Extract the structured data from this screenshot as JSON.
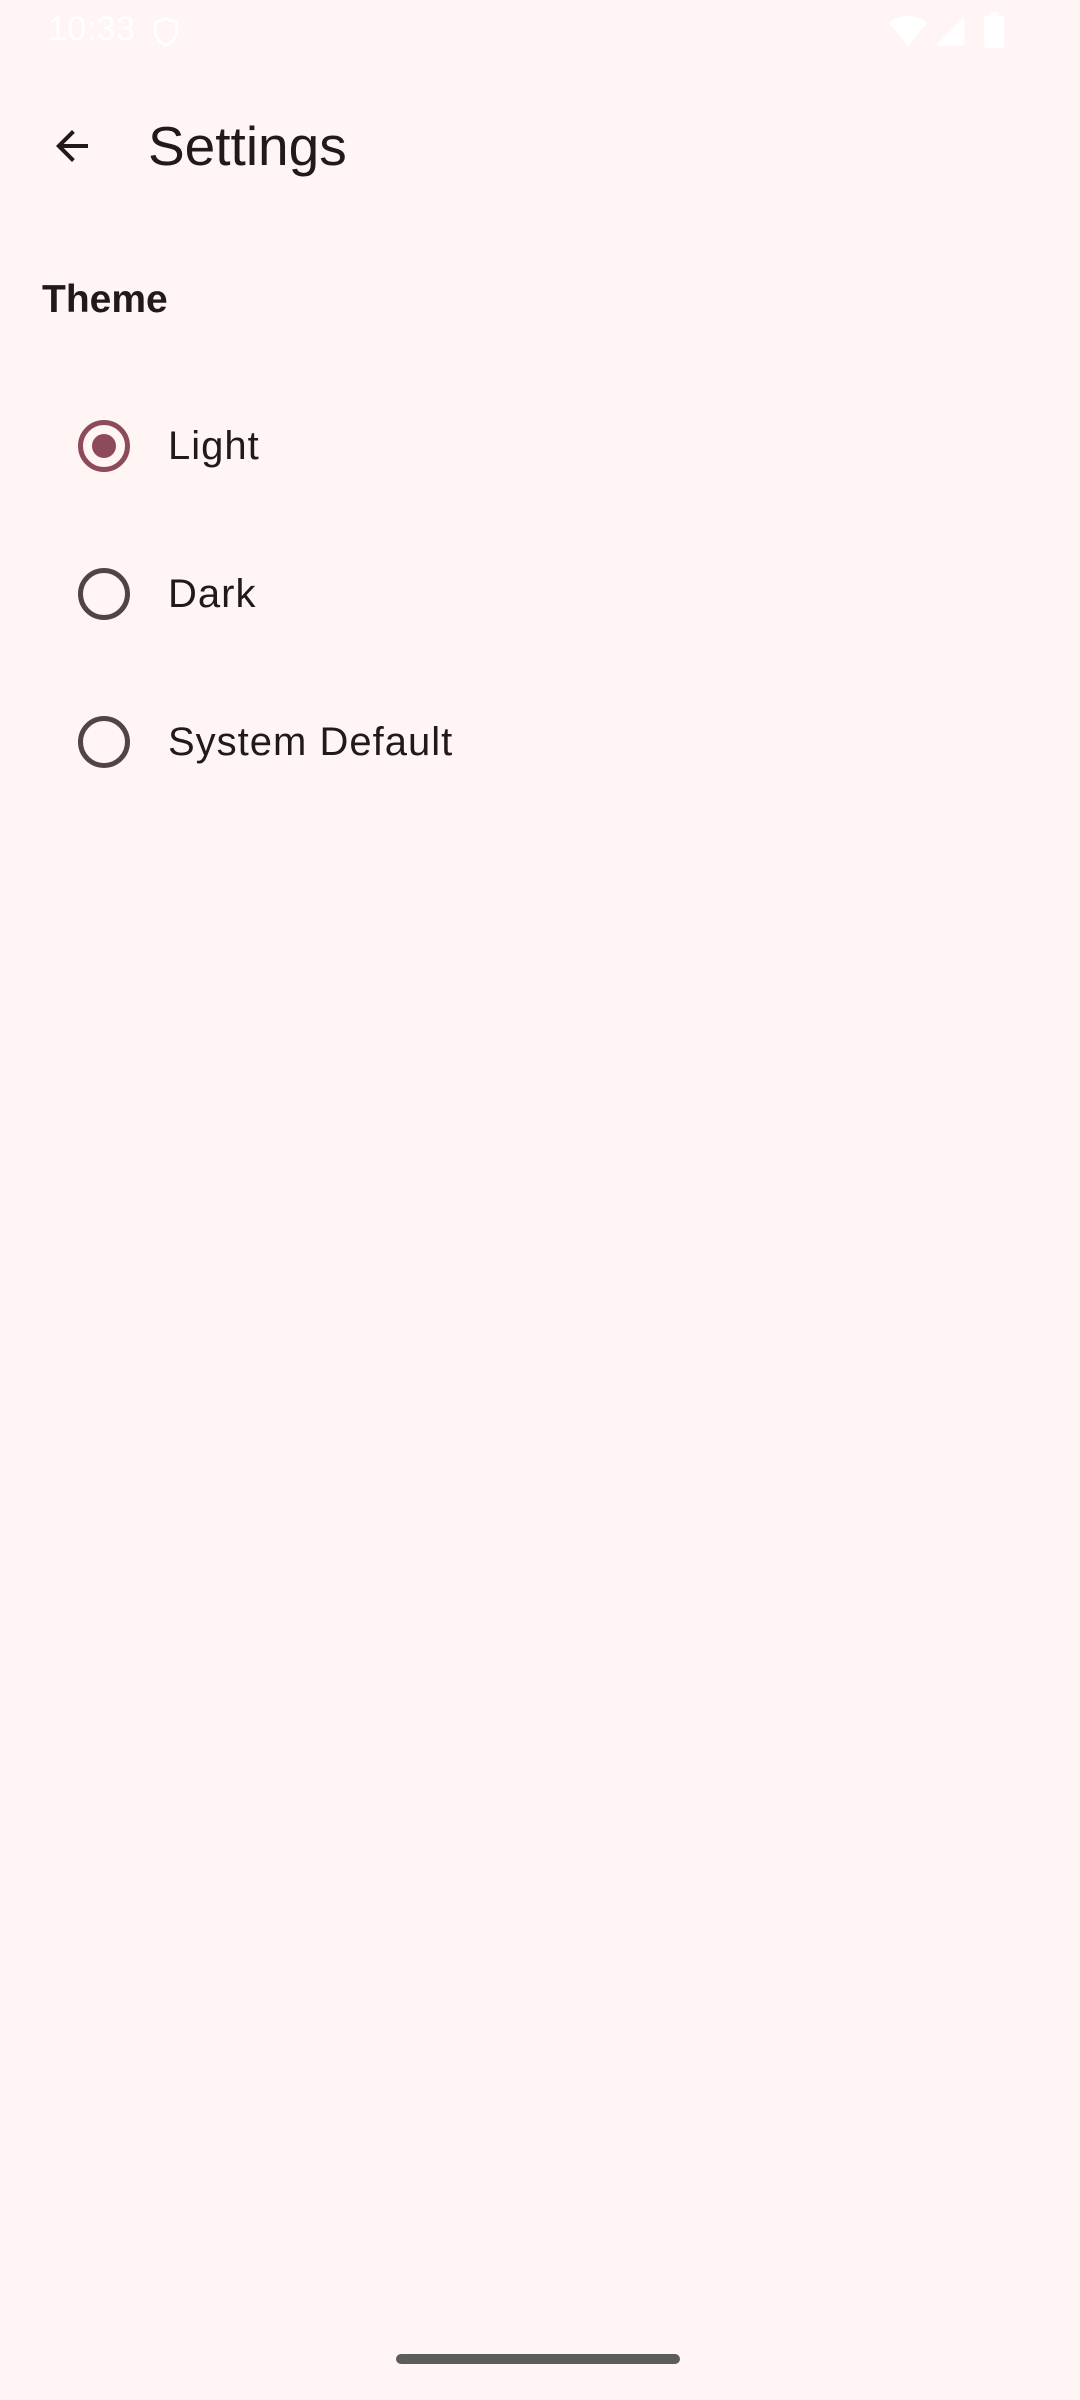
{
  "status_bar": {
    "time": "10:33",
    "icons": [
      "vpn-shield-icon",
      "wifi-icon",
      "cellular-signal-icon",
      "battery-icon"
    ]
  },
  "top_bar": {
    "back_icon": "arrow-back-icon",
    "title": "Settings"
  },
  "theme_section": {
    "title": "Theme",
    "selected": "Light",
    "options": [
      {
        "label": "Light",
        "checked": true
      },
      {
        "label": "Dark",
        "checked": false
      },
      {
        "label": "System Default",
        "checked": false
      }
    ]
  },
  "colors": {
    "background": "#FFF5F4",
    "accent": "#8C4A5A",
    "text": "#201A1B",
    "radio_unchecked": "#524345"
  }
}
